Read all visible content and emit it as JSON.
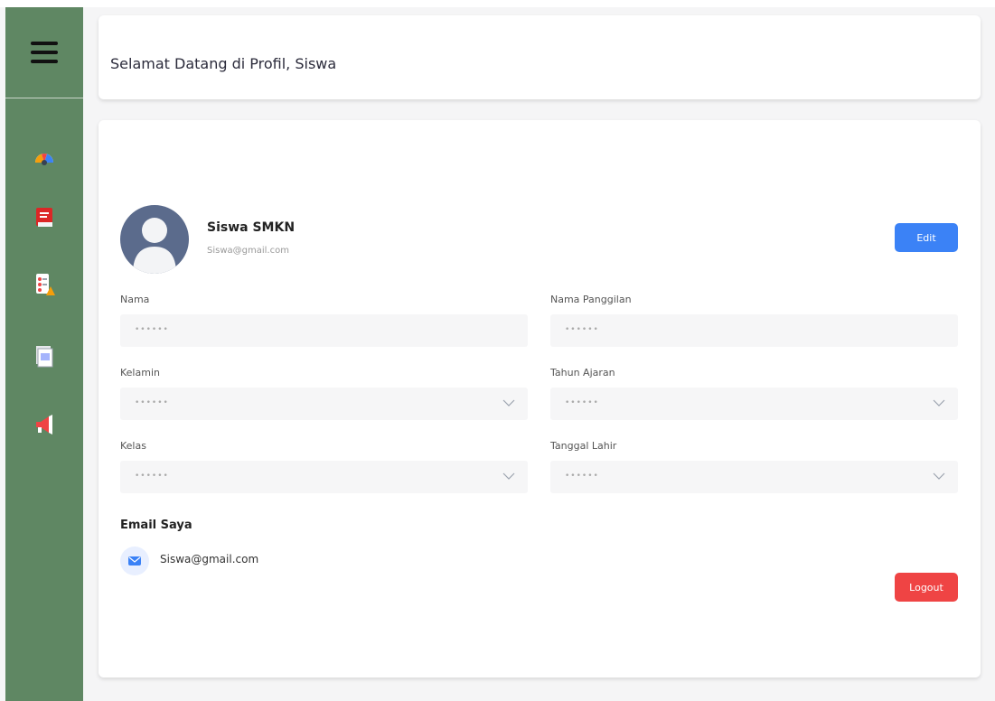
{
  "header": {
    "title": "Selamat Datang di Profil, Siswa"
  },
  "sidebar": {
    "menu_icon": "hamburger-menu-icon",
    "items": [
      {
        "icon": "dashboard-gauge-icon"
      },
      {
        "icon": "book-icon"
      },
      {
        "icon": "schedule-clipboard-icon"
      },
      {
        "icon": "document-icon"
      },
      {
        "icon": "megaphone-icon"
      }
    ]
  },
  "profile": {
    "name": "Siswa SMKN",
    "email": "Siswa@gmail.com",
    "edit_label": "Edit",
    "logout_label": "Logout"
  },
  "form": {
    "placeholder": "••••••",
    "nama_label": "Nama",
    "nama_panggilan_label": "Nama Panggilan",
    "kelamin_label": "Kelamin",
    "tahun_ajaran_label": "Tahun Ajaran",
    "kelas_label": "Kelas",
    "tanggal_lahir_label": "Tanggal Lahir"
  },
  "email_section": {
    "heading": "Email Saya",
    "email": "Siswa@gmail.com"
  },
  "colors": {
    "sidebar": "#5f8763",
    "edit_button": "#3b82f6",
    "logout_button": "#ef4444"
  }
}
